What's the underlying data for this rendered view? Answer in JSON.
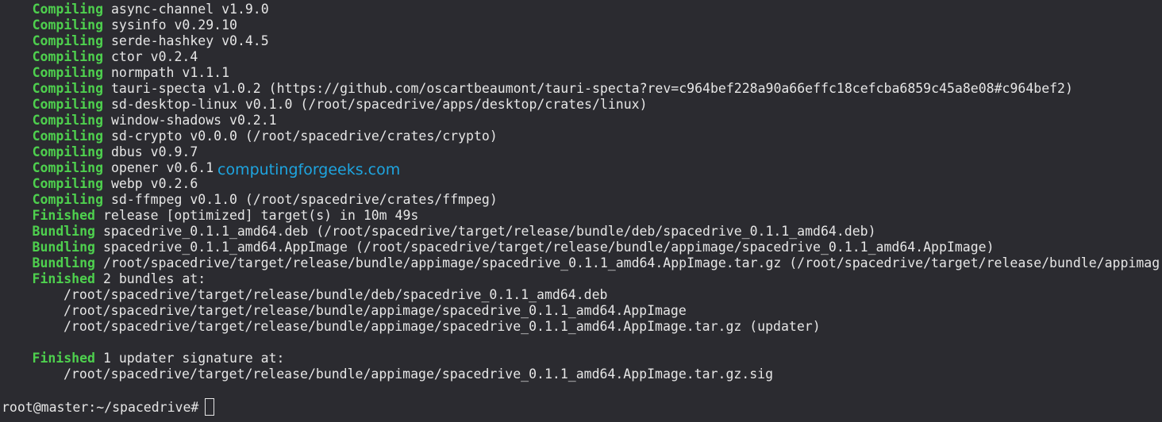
{
  "terminal": {
    "lines": [
      {
        "tag": "Compiling",
        "msg": "async-channel v1.9.0"
      },
      {
        "tag": "Compiling",
        "msg": "sysinfo v0.29.10"
      },
      {
        "tag": "Compiling",
        "msg": "serde-hashkey v0.4.5"
      },
      {
        "tag": "Compiling",
        "msg": "ctor v0.2.4"
      },
      {
        "tag": "Compiling",
        "msg": "normpath v1.1.1"
      },
      {
        "tag": "Compiling",
        "msg": "tauri-specta v1.0.2 (https://github.com/oscartbeaumont/tauri-specta?rev=c964bef228a90a66effc18cefcba6859c45a8e08#c964bef2)"
      },
      {
        "tag": "Compiling",
        "msg": "sd-desktop-linux v0.1.0 (/root/spacedrive/apps/desktop/crates/linux)"
      },
      {
        "tag": "Compiling",
        "msg": "window-shadows v0.2.1"
      },
      {
        "tag": "Compiling",
        "msg": "sd-crypto v0.0.0 (/root/spacedrive/crates/crypto)"
      },
      {
        "tag": "Compiling",
        "msg": "dbus v0.9.7"
      },
      {
        "tag": "Compiling",
        "msg": "opener v0.6.1"
      },
      {
        "tag": "Compiling",
        "msg": "webp v0.2.6"
      },
      {
        "tag": "Compiling",
        "msg": "sd-ffmpeg v0.1.0 (/root/spacedrive/crates/ffmpeg)"
      },
      {
        "tag": "Finished",
        "msg": "release [optimized] target(s) in 10m 49s"
      },
      {
        "tag": "Bundling",
        "msg": "spacedrive_0.1.1_amd64.deb (/root/spacedrive/target/release/bundle/deb/spacedrive_0.1.1_amd64.deb)"
      },
      {
        "tag": "Bundling",
        "msg": "spacedrive_0.1.1_amd64.AppImage (/root/spacedrive/target/release/bundle/appimage/spacedrive_0.1.1_amd64.AppImage)"
      },
      {
        "tag": "Bundling",
        "msg": "/root/spacedrive/target/release/bundle/appimage/spacedrive_0.1.1_amd64.AppImage.tar.gz (/root/spacedrive/target/release/bundle/appimag"
      },
      {
        "tag": "Finished",
        "msg": "2 bundles at:"
      }
    ],
    "bundle_paths": [
      "/root/spacedrive/target/release/bundle/deb/spacedrive_0.1.1_amd64.deb",
      "/root/spacedrive/target/release/bundle/appimage/spacedrive_0.1.1_amd64.AppImage",
      "/root/spacedrive/target/release/bundle/appimage/spacedrive_0.1.1_amd64.AppImage.tar.gz (updater)"
    ],
    "signature": {
      "tag": "Finished",
      "msg": "1 updater signature at:",
      "path": "/root/spacedrive/target/release/bundle/appimage/spacedrive_0.1.1_amd64.AppImage.tar.gz.sig"
    },
    "prompt": "root@master:~/spacedrive#",
    "watermark": "computingforgeeks.com",
    "colors": {
      "background": "#2b2b30",
      "tag_green": "#4ed04e",
      "text": "#e6e6e6",
      "watermark_blue": "#1ea5e0"
    }
  }
}
